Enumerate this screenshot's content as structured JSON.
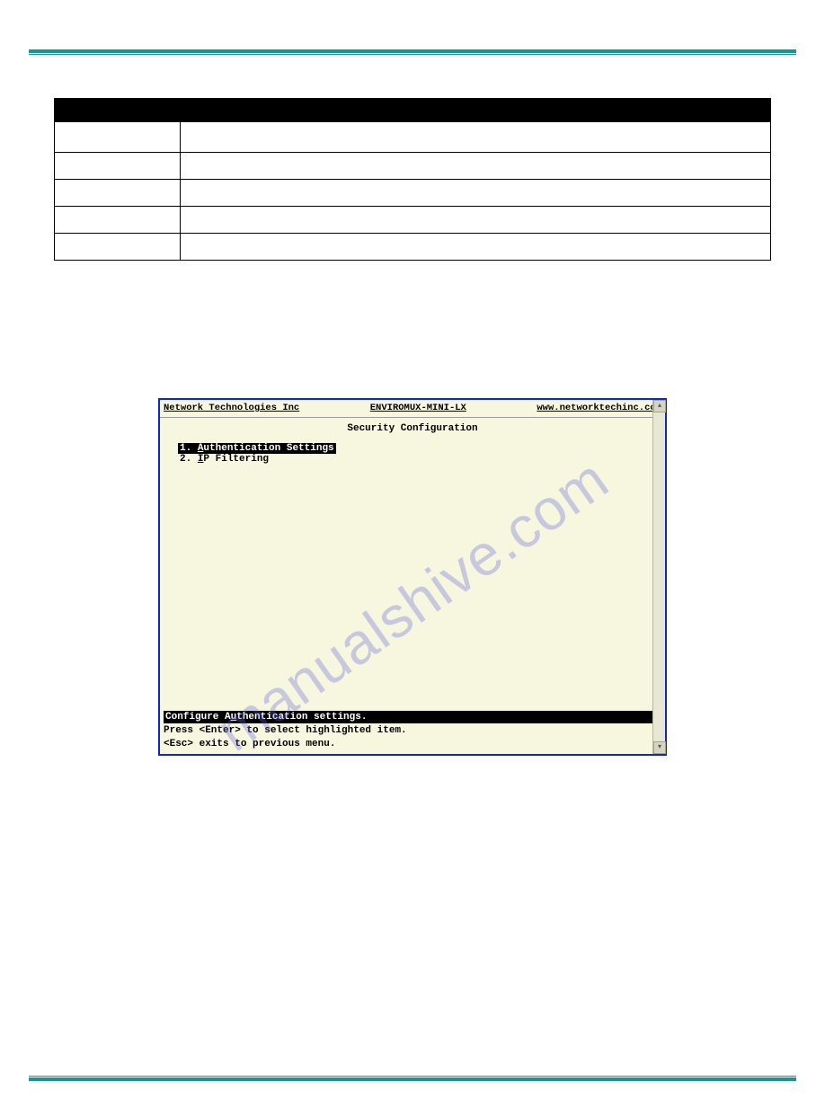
{
  "table": {
    "headers": [
      "",
      ""
    ],
    "rows": [
      [
        "",
        ""
      ],
      [
        "",
        ""
      ],
      [
        "",
        ""
      ],
      [
        "",
        ""
      ],
      [
        "",
        ""
      ]
    ]
  },
  "section_heading": "",
  "terminal": {
    "bar_left": "Network Technologies Inc",
    "bar_center": "ENVIROMUX-MINI-LX",
    "bar_right": "www.networktechinc.com",
    "title": "Security Configuration",
    "menu": [
      {
        "num": "1.",
        "hotkey": "A",
        "rest": "uthentication Settings",
        "selected": true
      },
      {
        "num": "2.",
        "hotkey": "I",
        "rest": "P Filtering",
        "selected": false
      }
    ],
    "status_pre": "Configure A",
    "status_hot": "u",
    "status_post": "thentication settings.",
    "hint1": "Press <Enter> to select highlighted item.",
    "hint2": "<Esc> exits to previous menu."
  },
  "watermark": "manualshive.com"
}
